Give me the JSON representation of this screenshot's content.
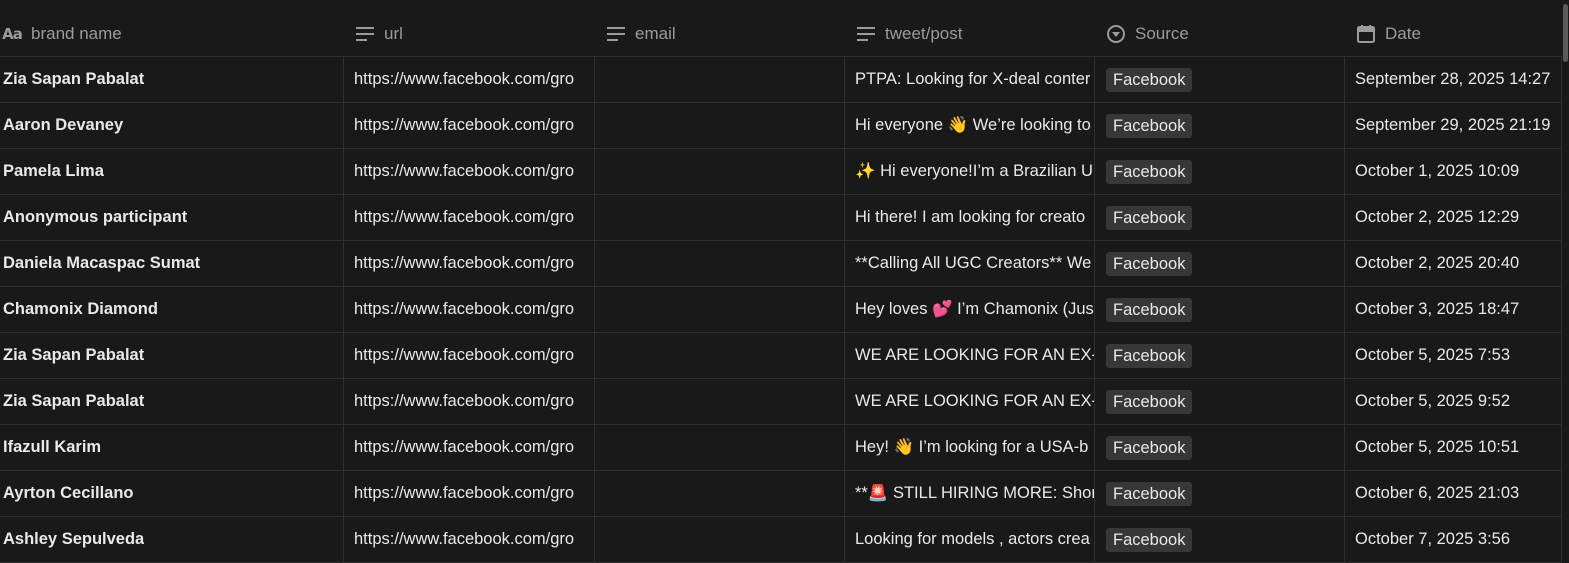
{
  "columns": {
    "brand": {
      "label": "brand name",
      "icon": "text-property-icon"
    },
    "url": {
      "label": "url",
      "icon": "lines-icon"
    },
    "email": {
      "label": "email",
      "icon": "lines-icon"
    },
    "post": {
      "label": "tweet/post",
      "icon": "lines-icon"
    },
    "source": {
      "label": "Source",
      "icon": "select-circle-icon"
    },
    "date": {
      "label": "Date",
      "icon": "calendar-icon"
    }
  },
  "type_glyph": "Aa",
  "rows": [
    {
      "brand": "Zia Sapan Pabalat",
      "url": "https://www.facebook.com/gro",
      "email": "",
      "post": "PTPA: Looking for X-deal conter",
      "source": "Facebook",
      "date": "September 28, 2025 14:27"
    },
    {
      "brand": "Aaron Devaney",
      "url": "https://www.facebook.com/gro",
      "email": "",
      "post": "Hi everyone 👋 We’re looking to",
      "source": "Facebook",
      "date": "September 29, 2025 21:19"
    },
    {
      "brand": "Pamela Lima",
      "url": "https://www.facebook.com/gro",
      "email": "",
      "post": "✨ Hi everyone!I’m a Brazilian U",
      "source": "Facebook",
      "date": "October 1, 2025 10:09"
    },
    {
      "brand": "Anonymous participant",
      "url": "https://www.facebook.com/gro",
      "email": "",
      "post": "Hi there! I am looking for creato",
      "source": "Facebook",
      "date": "October 2, 2025 12:29"
    },
    {
      "brand": "Daniela Macaspac Sumat",
      "url": "https://www.facebook.com/gro",
      "email": "",
      "post": "**Calling All UGC Creators** We",
      "source": "Facebook",
      "date": "October 2, 2025 20:40"
    },
    {
      "brand": "Chamonix Diamond",
      "url": "https://www.facebook.com/gro",
      "email": "",
      "post": "Hey loves 💕 I’m Chamonix (Jus",
      "source": "Facebook",
      "date": "October 3, 2025 18:47"
    },
    {
      "brand": "Zia Sapan Pabalat",
      "url": "https://www.facebook.com/gro",
      "email": "",
      "post": "WE ARE LOOKING FOR AN EX-D",
      "source": "Facebook",
      "date": "October 5, 2025 7:53"
    },
    {
      "brand": "Zia Sapan Pabalat",
      "url": "https://www.facebook.com/gro",
      "email": "",
      "post": "WE ARE LOOKING FOR AN EX-D",
      "source": "Facebook",
      "date": "October 5, 2025 9:52"
    },
    {
      "brand": "Ifazull Karim",
      "url": "https://www.facebook.com/gro",
      "email": "",
      "post": "Hey! 👋 I’m looking for a USA-b",
      "source": "Facebook",
      "date": "October 5, 2025 10:51"
    },
    {
      "brand": "Ayrton Cecillano",
      "url": "https://www.facebook.com/gro",
      "email": "",
      "post": "**🚨 STILL HIRING MORE: Short",
      "source": "Facebook",
      "date": "October 6, 2025 21:03"
    },
    {
      "brand": "Ashley Sepulveda",
      "url": "https://www.facebook.com/gro",
      "email": "",
      "post": "Looking for models , actors crea",
      "source": "Facebook",
      "date": "October 7, 2025 3:56"
    }
  ]
}
